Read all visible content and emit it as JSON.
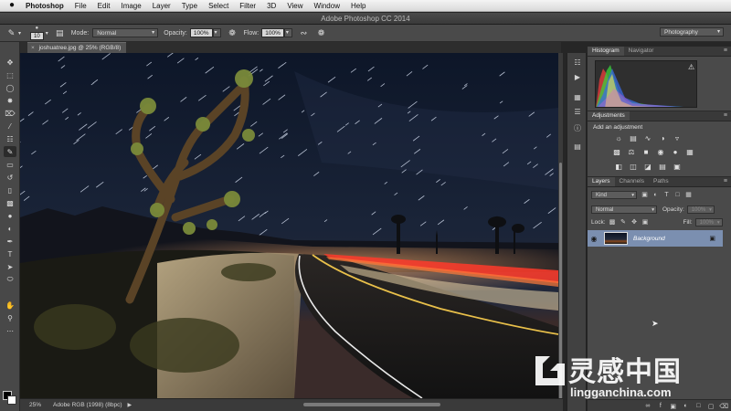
{
  "menubar": {
    "app_name": "Photoshop",
    "items": [
      "File",
      "Edit",
      "Image",
      "Layer",
      "Type",
      "Select",
      "Filter",
      "3D",
      "View",
      "Window",
      "Help"
    ]
  },
  "window": {
    "title": "Adobe Photoshop CC 2014"
  },
  "options_bar": {
    "brush_size": "10",
    "mode_label": "Mode:",
    "mode_value": "Normal",
    "opacity_label": "Opacity:",
    "opacity_value": "100%",
    "flow_label": "Flow:",
    "flow_value": "100%",
    "workspace": "Photography"
  },
  "document": {
    "tab_title": "joshuatree.jpg @ 25% (RGB/8)",
    "close_glyph": "×"
  },
  "status_bar": {
    "zoom": "25%",
    "info": "Adobe RGB (1998) (8bpc)",
    "arrow": "▶"
  },
  "panels": {
    "histogram": {
      "tabs": [
        "Histogram",
        "Navigator"
      ],
      "warning": "⚠"
    },
    "adjustments": {
      "tab": "Adjustments",
      "title": "Add an adjustment"
    },
    "layers": {
      "tabs": [
        "Layers",
        "Channels",
        "Paths"
      ],
      "filter_kind": "Kind",
      "blend_mode": "Normal",
      "opacity_label": "Opacity:",
      "opacity_value": "100%",
      "lock_label": "Lock:",
      "fill_label": "Fill:",
      "fill_value": "100%",
      "layer_name": "Background"
    },
    "menu_glyph": "≡"
  },
  "watermark": {
    "chinese": "灵感中国",
    "url": "lingganchina.com"
  },
  "colors": {
    "panel_bg": "#4a4a4a",
    "selected_layer": "#7b8fb0",
    "taillight_red": "#ff3a2a"
  },
  "icons": {
    "apple": "",
    "brush": "✎",
    "eye": "◉",
    "lock": "▣"
  }
}
